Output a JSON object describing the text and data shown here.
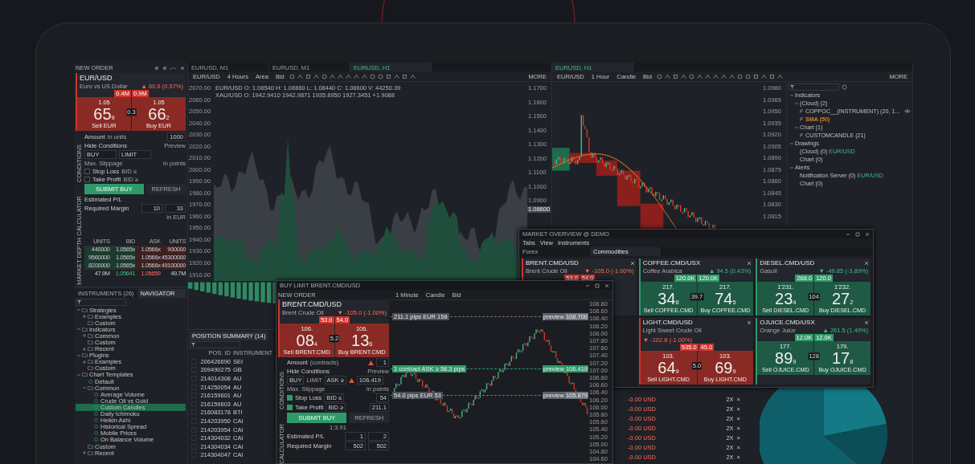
{
  "order_panel": {
    "header": "NEW ORDER",
    "quote": {
      "name": "EUR/USD",
      "description": "Euro vs US Dollar",
      "change": "▲ 60.6 (0.57%)",
      "kind": "down",
      "volumes": [
        "0.4M",
        "0.9M"
      ],
      "sell_pre": "1.05",
      "sell_big": "65",
      "sell_small": "9",
      "spread": "0.3",
      "buy_pre": "1.05",
      "buy_big": "66",
      "buy_small": "2",
      "sell_label": "Sell EUR",
      "buy_label": "Buy EUR"
    },
    "form": {
      "section": "CONDITIONS",
      "amount_label": "Amount",
      "amount_unit": "in units",
      "amount_value": "1000",
      "toggle": "Hide Conditions",
      "preview": "Preview",
      "side": "BUY",
      "type": "LIMIT",
      "slippage": "Max. Slippage",
      "points": "in points",
      "stop_loss": {
        "label": "Stop Loss",
        "checked": false,
        "value": "BID ≤"
      },
      "take_profit": {
        "label": "Take Profit",
        "checked": false,
        "value": "BID ≥"
      },
      "submit": "SUBMIT BUY",
      "refresh": "REFRESH"
    },
    "calculator": {
      "section": "CALCULATOR",
      "rows": [
        {
          "label": "Estimated P/L",
          "values": []
        },
        {
          "label": "Required Margin",
          "values": [
            "10",
            "33"
          ]
        }
      ],
      "currency": "in EUR"
    },
    "depth": {
      "section": "MARKET DEPTH",
      "columns": [
        "UNITS",
        "BID",
        "ASK",
        "UNITS"
      ],
      "rows": [
        [
          "440000",
          "1.0565x",
          "1.0566x",
          "900000"
        ],
        [
          "9560000",
          "1.0565x",
          "1.0566x",
          "45300000"
        ],
        [
          "8200000",
          "1.0565x",
          "1.0566x",
          "49100000"
        ]
      ],
      "totals": [
        "47.9M",
        "1.05641",
        "1.05659",
        "49.7M"
      ]
    }
  },
  "instruments": {
    "tabs": [
      {
        "label": "INSTRUMENTS (26)",
        "selected": false
      },
      {
        "label": "NAVIGATOR",
        "selected": true
      }
    ],
    "tree": [
      {
        "label": "Strategies",
        "kind": "folder",
        "expanded": true,
        "selected": false,
        "children": [
          {
            "label": "Examples",
            "kind": "folder",
            "expanded": false,
            "selected": false
          },
          {
            "label": "Custom",
            "kind": "folder",
            "selected": false
          }
        ]
      },
      {
        "label": "Indicators",
        "kind": "folder",
        "expanded": true,
        "selected": false,
        "children": [
          {
            "label": "Common",
            "kind": "folder",
            "expanded": false,
            "selected": false
          },
          {
            "label": "Custom",
            "kind": "folder",
            "selected": false
          },
          {
            "label": "Recent",
            "kind": "folder",
            "expanded": false,
            "selected": false
          }
        ]
      },
      {
        "label": "Plugins",
        "kind": "folder",
        "expanded": true,
        "selected": false,
        "children": [
          {
            "label": "Examples",
            "kind": "folder",
            "expanded": false,
            "selected": false
          },
          {
            "label": "Custom",
            "kind": "folder",
            "selected": false
          }
        ]
      },
      {
        "label": "Chart Templates",
        "kind": "folder",
        "expanded": true,
        "selected": false,
        "children": [
          {
            "label": "Default",
            "kind": "template",
            "selected": false
          },
          {
            "label": "Common",
            "kind": "folder",
            "expanded": true,
            "selected": false,
            "children": [
              {
                "label": "Average Volume",
                "kind": "template",
                "selected": false
              },
              {
                "label": "Crude Oil vs Gold",
                "kind": "template",
                "selected": false
              },
              {
                "label": "Custom Candles",
                "kind": "template",
                "selected": true
              },
              {
                "label": "Daily Ichimoku",
                "kind": "template",
                "selected": false
              },
              {
                "label": "Heikin Ashi",
                "kind": "template",
                "selected": false
              },
              {
                "label": "Historical Spread",
                "kind": "template",
                "selected": false
              },
              {
                "label": "Mobile Prices",
                "kind": "template",
                "selected": false
              },
              {
                "label": "On Balance Volume",
                "kind": "template",
                "selected": false
              }
            ]
          },
          {
            "label": "Custom",
            "kind": "folder",
            "selected": false
          },
          {
            "label": "Recent",
            "kind": "folder",
            "expanded": false,
            "selected": false
          }
        ]
      }
    ]
  },
  "area_chart": {
    "tabs": [
      {
        "label": "EURUSD, M1",
        "selected": false
      },
      {
        "label": "EURUSD, M1",
        "selected": false
      },
      {
        "label": "EURUSD, H1",
        "selected": true
      }
    ],
    "toolbar": [
      "EUR/USD",
      "4 Hours",
      "Area",
      "Bid"
    ],
    "more": "MORE",
    "legend": [
      "EUR/USD O: 1.08540 H: 1.08860 L: 1.08440 C: 1.08600 V: 44250.39",
      "XAU/USD O: 1942.9410 1942.9871 1935.8950 1927.3451 +1.9088"
    ],
    "left_axis": [
      "2070.00",
      "2060.00",
      "2050.00",
      "2040.00",
      "2030.00",
      "2020.00",
      "2010.00",
      "2000.00",
      "1990.00",
      "1980.00",
      "1970.00",
      "1960.00",
      "1950.00",
      "1940.00",
      "1930.00",
      "1920.00",
      "1910.00"
    ],
    "right_axis": [
      "1.1700",
      "1.1600",
      "1.1500",
      "1.1400",
      "1.1300",
      "1.1200",
      "1.1100",
      "1.1000",
      "1.0900"
    ],
    "price_tag": "1.08600"
  },
  "positions": {
    "tabs": [
      {
        "label": "POSITION SUMMARY (14)",
        "selected": true
      }
    ],
    "columns": [
      "POS. ID",
      "INSTRUMENT"
    ],
    "rows": [
      {
        "id": "206426690",
        "instrument": "SEI",
        "checked": false
      },
      {
        "id": "209490275",
        "instrument": "GB",
        "checked": false
      },
      {
        "id": "214014308",
        "instrument": "AU",
        "checked": false
      },
      {
        "id": "214250054",
        "instrument": "AU",
        "checked": false
      },
      {
        "id": "216159601",
        "instrument": "AU",
        "checked": false
      },
      {
        "id": "216159603",
        "instrument": "AU",
        "checked": false
      },
      {
        "id": "216083178",
        "instrument": "BTI",
        "checked": false
      },
      {
        "id": "214203950",
        "instrument": "CAI",
        "checked": false
      },
      {
        "id": "214203954",
        "instrument": "CAI",
        "checked": false
      },
      {
        "id": "214304032",
        "instrument": "CAI",
        "checked": false
      },
      {
        "id": "214304034",
        "instrument": "CAI",
        "checked": false
      },
      {
        "id": "214304047",
        "instrument": "CAI",
        "checked": false
      }
    ]
  },
  "candle_chart": {
    "tab": {
      "label": "EURUSD, H1",
      "selected": true
    },
    "toolbar": [
      "EUR/USD",
      "1 Hour",
      "Candle",
      "Bid"
    ],
    "more": "MORE",
    "right_axis": [
      "1.0980",
      "1.0965",
      "1.0950",
      "1.0935",
      "1.0920",
      "1.0905",
      "1.0890",
      "1.0875",
      "1.0860",
      "1.0845",
      "1.0830",
      "1.0815"
    ],
    "side_tree": [
      {
        "label": "Indicators",
        "kind": "group",
        "selected": false,
        "children": [
          {
            "label": "(Cloud) (2)",
            "kind": "group",
            "selected": false,
            "children": [
              {
                "label": "COPPOC__(INSTRUMENT) (20, 1...",
                "kind": "indicator",
                "visible": true,
                "selected": false
              },
              {
                "label": "SMA (50)",
                "kind": "indicator",
                "color": "#e07b2a",
                "selected": false
              }
            ]
          },
          {
            "label": "Chart (1)",
            "kind": "group",
            "selected": false,
            "children": [
              {
                "label": "CUSTOMCANDLE (21)",
                "kind": "indicator",
                "selected": false
              }
            ]
          }
        ]
      },
      {
        "label": "Drawings",
        "kind": "group",
        "selected": false,
        "children": [
          {
            "label": "(Cloud) (0)",
            "suffix": "EUR/USD",
            "kind": "entry",
            "selected": false
          },
          {
            "label": "Chart (0)",
            "kind": "entry",
            "selected": false
          }
        ]
      },
      {
        "label": "Alerts",
        "kind": "group",
        "selected": false,
        "children": [
          {
            "label": "Notification Server (0)",
            "suffix": "EUR/USD",
            "kind": "entry",
            "selected": false
          },
          {
            "label": "Chart (0)",
            "kind": "entry",
            "selected": false
          }
        ]
      }
    ]
  },
  "trade_rows": [
    {
      "amount": "-0.00 USD",
      "actions": [
        "2X",
        "×"
      ]
    },
    {
      "amount": "-0.00 USD",
      "actions": [
        "2X",
        "×"
      ]
    },
    {
      "amount": "-0.00 USD",
      "actions": [
        "2X",
        "×"
      ]
    },
    {
      "amount": "-0.00 USD",
      "actions": [
        "2X",
        "×"
      ]
    },
    {
      "amount": "-0.00 USD",
      "actions": [
        "2X",
        "×"
      ]
    },
    {
      "amount": "-0.00 USD",
      "actions": [
        "2X",
        "×"
      ]
    },
    {
      "amount": "-0.00 USD",
      "actions": [
        "2X",
        "×"
      ]
    }
  ],
  "market_overview": {
    "title": "MARKET OVERVIEW @ DEMO",
    "menu": [
      "Tabs",
      "View",
      "Instruments"
    ],
    "tabs": [
      {
        "label": "Forex",
        "selected": false
      },
      {
        "label": "Commodities",
        "selected": true
      }
    ],
    "tiles": [
      {
        "name": "BRENT.CMD/USD",
        "description": "Brent Crude Oil",
        "change": "▼ -105.0 (-1.00%)",
        "kind": "down",
        "volumes": [
          "53.0",
          "54.0"
        ]
      },
      {
        "name": "COFFEE.CMD/USX",
        "description": "Coffee Arabica",
        "change": "▲ 94.5 (0.43%)",
        "kind": "up",
        "volumes": [
          "120.0K",
          "120.0K"
        ],
        "sell_pre": "217.",
        "sell_big": "34",
        "sell_small": "8",
        "spread": "39.7",
        "buy_pre": "217.",
        "buy_big": "74",
        "buy_small": "5",
        "sell_label": "Sell COFFEE.CMD",
        "buy_label": "Buy COFFEE.CMD"
      },
      {
        "name": "DIESEL.CMD/USD",
        "description": "Gasoil",
        "change": "▼ -49.85 (-3.89%)",
        "kind": "up",
        "volumes": [
          "268.0",
          "120.0"
        ],
        "sell_pre": "1'231.",
        "sell_big": "23",
        "sell_small": "4",
        "spread": "104",
        "buy_pre": "1'232.",
        "buy_big": "27",
        "buy_small": "2",
        "sell_label": "Sell DIESEL.CMD",
        "buy_label": "Buy DIESEL.CMD"
      },
      {
        "name": "LIGHT.CMD/USD",
        "description": "Light Sweet Crude Oil",
        "change": "▼ -102.8 (-1.00%)",
        "kind": "down",
        "volumes": [
          "535.0",
          "45.0"
        ],
        "sell_pre": "103.",
        "sell_big": "64",
        "sell_small": "9",
        "spread": "5.0",
        "buy_pre": "103.",
        "buy_big": "69",
        "buy_small": "9",
        "sell_label": "Sell LIGHT.CMD",
        "buy_label": "Buy LIGHT.CMD"
      },
      {
        "name": "OJUICE.CMD/USX",
        "description": "Orange Juice",
        "change": "▲ 261.5 (1.49%)",
        "kind": "up",
        "volumes": [
          "12.0K",
          "12.0K"
        ],
        "sell_pre": "177.",
        "sell_big": "89",
        "sell_small": "9",
        "spread": "128",
        "buy_pre": "179.",
        "buy_big": "17",
        "buy_small": "8",
        "sell_label": "Sell OJUICE.CMD",
        "buy_label": "Buy OJUICE.CMD"
      }
    ]
  },
  "brent_window": {
    "title": "BUY LIMIT BRENT.CMD/USD",
    "header": "NEW ORDER",
    "quote": {
      "name": "BRENT.CMD/USD",
      "description": "Brent Crude Oil",
      "change": "▼ -105.0 (-1.00%)",
      "kind": "down",
      "volumes": [
        "53.0",
        "54.0"
      ],
      "sell_pre": "106.",
      "sell_big": "08",
      "sell_small": "4",
      "spread": "5.2",
      "buy_pre": "106.",
      "buy_big": "13",
      "buy_small": "6",
      "sell_label": "Sell BRENT.CMD",
      "buy_label": "Buy BRENT.CMD"
    },
    "form": {
      "section": "CONDITIONS",
      "amount_label": "Amount",
      "amount_unit": "(contracts)",
      "amount_value": "1",
      "toggle": "Hide Conditions",
      "preview": "Preview",
      "side": "BUY",
      "type_label": "LIMIT",
      "price_side": "ASK ≥",
      "price": "106.419",
      "slippage": "Max. Slippage",
      "points": "in points",
      "stop_loss": {
        "label": "Stop Loss",
        "checked": true,
        "value": "BID ≤",
        "amount": "54"
      },
      "take_profit": {
        "label": "Take Profit",
        "checked": true,
        "value": "BID ≥",
        "amount": "211.1"
      },
      "submit": "SUBMIT BUY",
      "refresh": "REFRESH"
    },
    "calculator": {
      "section": "CALCULATOR",
      "ratio": "1:3.91",
      "rows": [
        {
          "label": "Estimated P/L",
          "values": [
            "1",
            "2"
          ]
        },
        {
          "label": "Required Margin",
          "values": [
            "502",
            "502"
          ]
        }
      ]
    },
    "chart": {
      "toolbar": [
        "1 Minute",
        "Candle",
        "Bid"
      ],
      "axis": [
        "108.80",
        "108.60",
        "108.40",
        "108.20",
        "108.00",
        "107.80",
        "107.60",
        "107.40",
        "107.20",
        "107.00",
        "106.80",
        "106.60",
        "106.40",
        "106.20",
        "106.00",
        "105.80",
        "105.60",
        "105.40",
        "105.20",
        "105.00",
        "104.80",
        "104.60"
      ],
      "lines": [
        {
          "label": "211.1 pips EUR 158",
          "tag": "preview",
          "price": "108.700",
          "kind": "take_profit"
        },
        {
          "label": "1 contract ASK ≥ 58.3 pips",
          "tag": "preview",
          "price": "106.419",
          "kind": "entry"
        },
        {
          "label": "54.0 pips EUR 53",
          "tag": "preview",
          "price": "105.879",
          "kind": "stop_loss"
        }
      ]
    }
  }
}
